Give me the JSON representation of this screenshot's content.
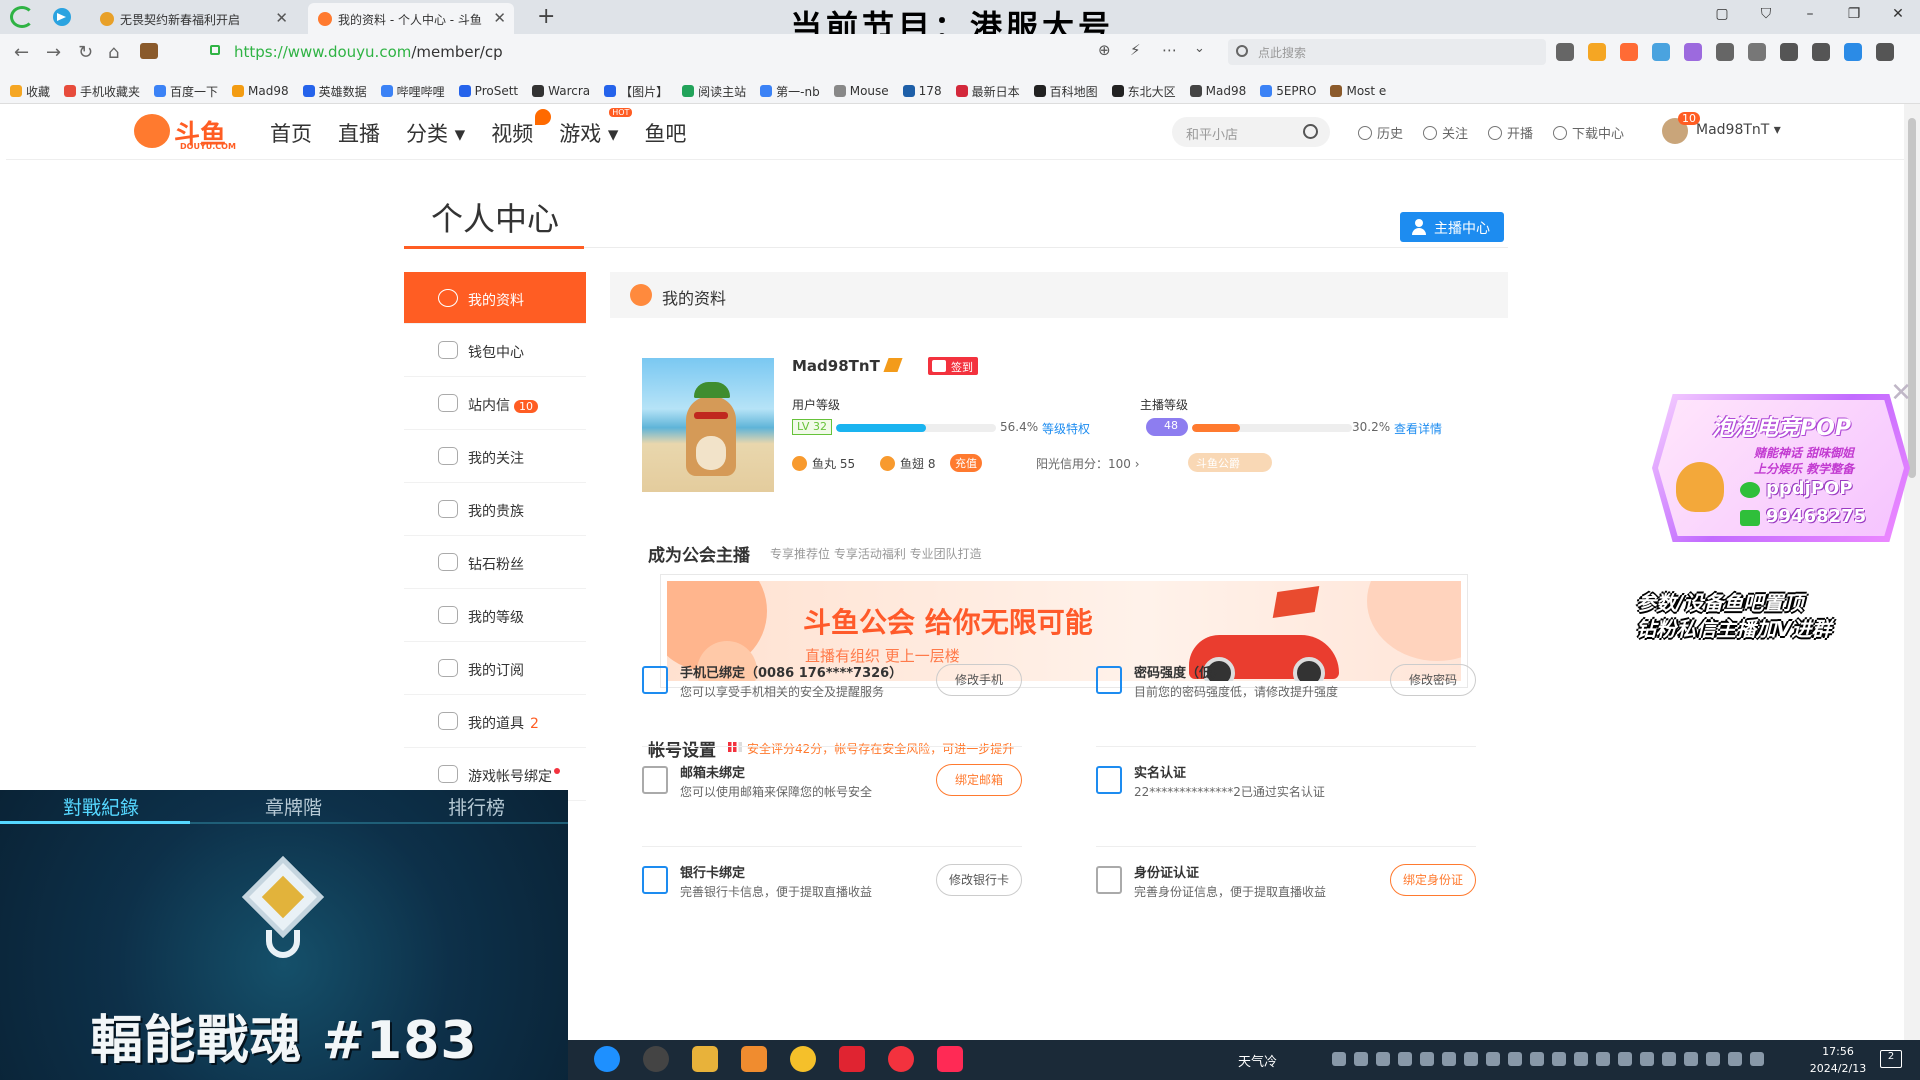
{
  "browser": {
    "tabs": [
      {
        "title": "无畏契约新春福利开启",
        "active": false
      },
      {
        "title": "我的资料 - 个人中心 - 斗鱼",
        "active": true
      }
    ],
    "overlay_title": "当前节目：港服大号",
    "url_host": "https://www.douyu.com",
    "url_path": "/member/cp",
    "search_placeholder": "点此搜索",
    "bookmarks": [
      "收藏",
      "手机收藏夹",
      "百度一下",
      "Mad98",
      "英雄数据",
      "哔哩哔哩",
      "ProSett",
      "Warcra",
      "【图片】",
      "阅读主站",
      "第一-nb",
      "Mouse",
      "178",
      "最新日本",
      "百科地图",
      "东北大区",
      "Mad98",
      "5EPRO",
      "Most e"
    ]
  },
  "site": {
    "logo_text": "斗鱼",
    "logo_sub": "DOUYU.COM",
    "nav": [
      {
        "label": "首页",
        "mark": ""
      },
      {
        "label": "直播",
        "mark": ""
      },
      {
        "label": "分类 ▾",
        "mark": ""
      },
      {
        "label": "视频",
        "mark": "flame"
      },
      {
        "label": "游戏 ▾",
        "mark": "HOT"
      },
      {
        "label": "鱼吧",
        "mark": ""
      }
    ],
    "search_placeholder": "和平小店",
    "user_links": [
      "历史",
      "关注",
      "开播",
      "下载中心"
    ],
    "avatar_badge": "10",
    "username": "Mad98TnT ▾"
  },
  "center": {
    "title": "个人中心",
    "streamer_button": "主播中心",
    "sidebar": [
      {
        "label": "我的资料",
        "badge": "",
        "count": "",
        "dot": false,
        "active": true
      },
      {
        "label": "钱包中心",
        "badge": "",
        "count": "",
        "dot": false,
        "active": false
      },
      {
        "label": "站内信",
        "badge": "10",
        "count": "",
        "dot": false,
        "active": false
      },
      {
        "label": "我的关注",
        "badge": "",
        "count": "",
        "dot": false,
        "active": false
      },
      {
        "label": "我的贵族",
        "badge": "",
        "count": "",
        "dot": false,
        "active": false
      },
      {
        "label": "钻石粉丝",
        "badge": "",
        "count": "",
        "dot": false,
        "active": false
      },
      {
        "label": "我的等级",
        "badge": "",
        "count": "",
        "dot": false,
        "active": false
      },
      {
        "label": "我的订阅",
        "badge": "",
        "count": "",
        "dot": false,
        "active": false
      },
      {
        "label": "我的道具",
        "badge": "",
        "count": "2",
        "dot": false,
        "active": false
      },
      {
        "label": "游戏帐号绑定",
        "badge": "",
        "count": "",
        "dot": true,
        "active": false
      }
    ],
    "section_title": "我的资料",
    "profile": {
      "name": "Mad98TnT",
      "sign_badge": "签到",
      "user_level_label": "用户等级",
      "user_level_tag": "LV 32",
      "user_level_progress": 0.564,
      "user_level_pct": "56.4%",
      "user_level_link": "等级特权",
      "streamer_level_label": "主播等级",
      "streamer_level_tag": "48",
      "streamer_level_progress": 0.302,
      "streamer_level_pct": "30.2%",
      "streamer_level_link": "查看详情",
      "fish_balls": "鱼丸 55",
      "fish_wings": "鱼翅 8",
      "recharge": "充值",
      "credit": "阳光信用分：100 ›",
      "fan_club": "斗鱼公爵"
    },
    "guild": {
      "title": "成为公会主播",
      "subtitle": "专享推荐位 专享活动福利 专业团队打造",
      "headline": "斗鱼公会 给你无限可能",
      "tagline": "直播有组织  更上一层楼"
    },
    "account": {
      "title": "帐号设置",
      "warning": "安全评分42分，帐号存在安全风险，可进一步提升",
      "items": [
        {
          "title": "手机已绑定（0086 176****7326）",
          "desc": "您可以享受手机相关的安全及提醒服务",
          "button": "修改手机",
          "highlight": false
        },
        {
          "title": "密码强度（低）",
          "desc": "目前您的密码强度低，请修改提升强度",
          "button": "修改密码",
          "highlight": false
        },
        {
          "title": "邮箱未绑定",
          "desc": "您可以使用邮箱来保障您的帐号安全",
          "button": "绑定邮箱",
          "highlight": true
        },
        {
          "title": "实名认证",
          "desc": "22**************2已通过实名认证",
          "button": "",
          "highlight": false
        },
        {
          "title": "银行卡绑定",
          "desc": "完善银行卡信息，便于提取直播收益",
          "button": "修改银行卡",
          "highlight": false
        },
        {
          "title": "身份证认证",
          "desc": "完善身份证信息，便于提取直播收益",
          "button": "绑定身份证",
          "highlight": true
        }
      ]
    }
  },
  "game_overlay": {
    "tabs": [
      "對戰紀錄",
      "章牌階",
      "排行榜"
    ],
    "title": "輻能戰魂 #183"
  },
  "promo_overlay": {
    "title": "泡泡电竞POP",
    "line1": "赌能神话 甜味御姐",
    "line2": "上分娱乐 教学整备",
    "wechat": "ppdjPOP",
    "kook_id": "99468275",
    "caption_line1": "参数/设备鱼吧置顶",
    "caption_line2": "钻粉私信主播加V进群"
  },
  "taskbar": {
    "weather": "天气冷",
    "time": "17:56",
    "date": "2024/2/13",
    "notifications": "2"
  },
  "colors": {
    "brand": "#ff5d23",
    "link": "#1d8cf0",
    "success": "#2fb344"
  }
}
